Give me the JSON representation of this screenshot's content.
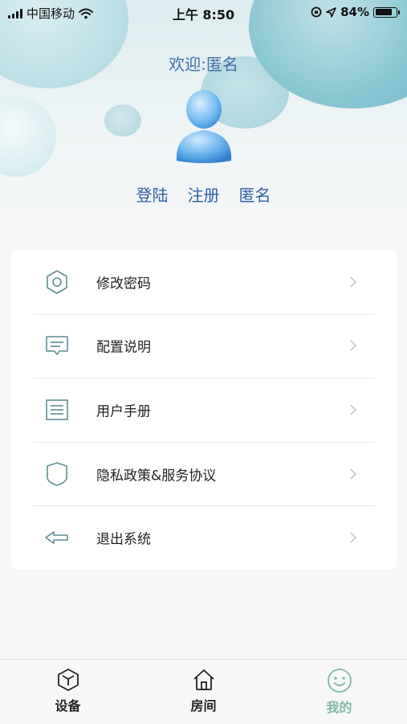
{
  "status_bar": {
    "carrier": "中国移动",
    "time": "上午 8:50",
    "battery_text": "84%",
    "battery_level": 0.84
  },
  "header": {
    "welcome": "欢迎:匿名",
    "links": {
      "login": "登陆",
      "register": "注册",
      "anonymous": "匿名"
    }
  },
  "menu": [
    {
      "label": "修改密码",
      "icon": "hexagon-settings-icon"
    },
    {
      "label": "配置说明",
      "icon": "message-icon"
    },
    {
      "label": "用户手册",
      "icon": "document-icon"
    },
    {
      "label": "隐私政策&服务协议",
      "icon": "shield-icon"
    },
    {
      "label": "退出系统",
      "icon": "arrow-left-icon"
    }
  ],
  "tabs": [
    {
      "label": "设备",
      "icon": "cube-icon",
      "active": false
    },
    {
      "label": "房间",
      "icon": "home-icon",
      "active": false
    },
    {
      "label": "我的",
      "icon": "smiley-icon",
      "active": true
    }
  ],
  "colors": {
    "accent_active_tab": "#7fb8a4",
    "link_blue": "#2f5fa0",
    "icon_teal": "#5f8c93"
  }
}
